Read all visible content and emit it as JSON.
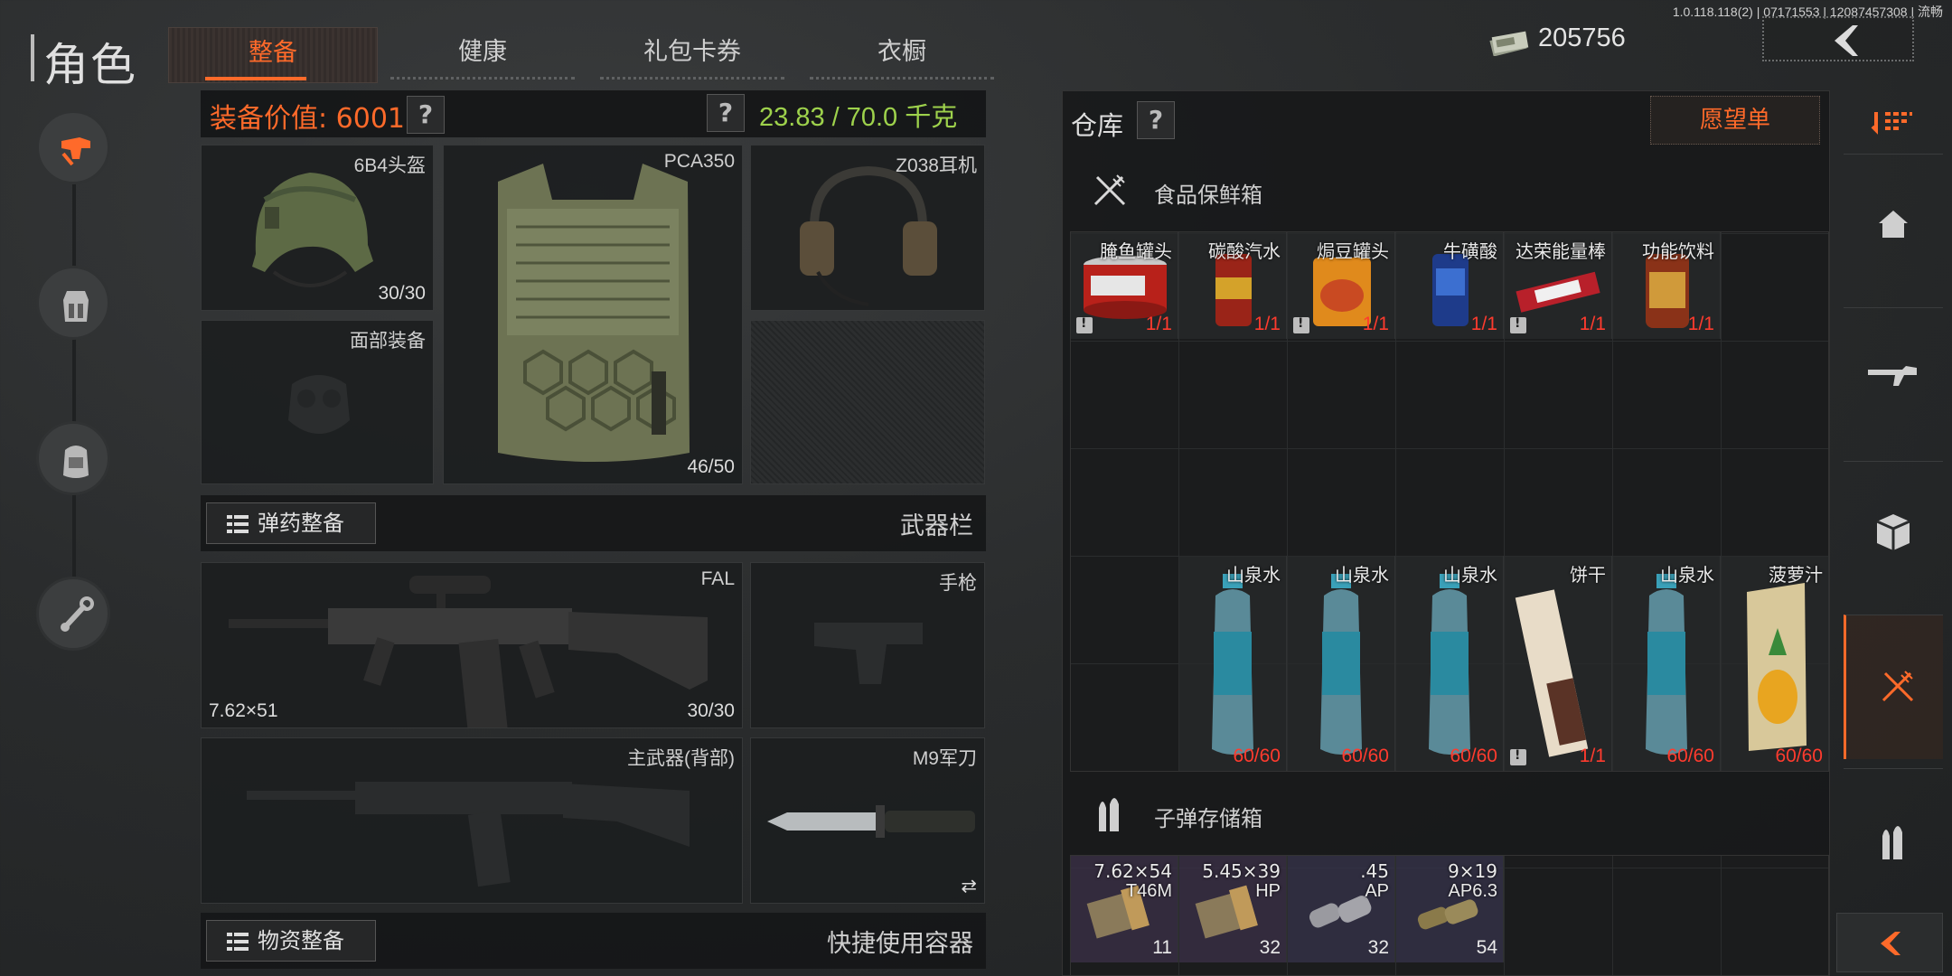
{
  "version": "1.0.118.118(2) | 07171553 | 12087457308 | 流畅",
  "page_title": "角色",
  "tabs": [
    {
      "label": "整备",
      "active": true
    },
    {
      "label": "健康",
      "active": false
    },
    {
      "label": "礼包卡券",
      "active": false
    },
    {
      "label": "衣橱",
      "active": false
    }
  ],
  "cash": "205756",
  "equipment": {
    "value_label": "装备价值: 60011",
    "weight": "23.83 / 70.0 千克",
    "help": "?",
    "slots": {
      "helmet": {
        "label": "6B4头盔",
        "count": "30/30"
      },
      "armor": {
        "label": "PCA350",
        "count": "46/50"
      },
      "headset": {
        "label": "Z038耳机"
      },
      "face": {
        "label": "面部装备"
      },
      "primary": {
        "label": "FAL",
        "caliber": "7.62×51",
        "count": "30/30"
      },
      "pistol": {
        "label": "手枪"
      },
      "primary_back": {
        "label": "主武器(背部)"
      },
      "knife": {
        "label": "M9军刀",
        "swap": "⇄"
      }
    },
    "ammo_button": "弹药整备",
    "weapons_title": "武器栏",
    "supply_button": "物资整备",
    "quick_title": "快捷使用容器"
  },
  "warehouse": {
    "title": "仓库",
    "wishlist": "愿望单",
    "food_box": {
      "title": "食品保鲜箱",
      "row1": [
        {
          "name": "腌鱼罐头",
          "count": "1/1",
          "locked": true
        },
        {
          "name": "碳酸汽水",
          "count": "1/1",
          "locked": false
        },
        {
          "name": "焗豆罐头",
          "count": "1/1",
          "locked": true
        },
        {
          "name": "牛磺酸",
          "count": "1/1",
          "locked": false
        },
        {
          "name": "达荣能量棒",
          "count": "1/1",
          "locked": true
        },
        {
          "name": "功能饮料",
          "count": "1/1",
          "locked": false
        }
      ],
      "row2": [
        {
          "name": "山泉水",
          "count": "60/60"
        },
        {
          "name": "山泉水",
          "count": "60/60"
        },
        {
          "name": "山泉水",
          "count": "60/60"
        },
        {
          "name": "饼干",
          "count": "1/1",
          "locked": true
        },
        {
          "name": "山泉水",
          "count": "60/60"
        },
        {
          "name": "菠萝汁",
          "count": "60/60"
        }
      ]
    },
    "ammo_box": {
      "title": "子弹存储箱",
      "items": [
        {
          "caliber": "7.62×54",
          "type": "T46M",
          "count": "11"
        },
        {
          "caliber": "5.45×39",
          "type": "HP",
          "count": "32"
        },
        {
          "caliber": ".45",
          "type": "AP",
          "count": "32"
        },
        {
          "caliber": "9×19",
          "type": "AP6.3",
          "count": "54"
        }
      ]
    }
  },
  "colors": {
    "accent": "#ff6a2a",
    "weight": "#9ed24c",
    "count_red": "#ff3b2e"
  }
}
